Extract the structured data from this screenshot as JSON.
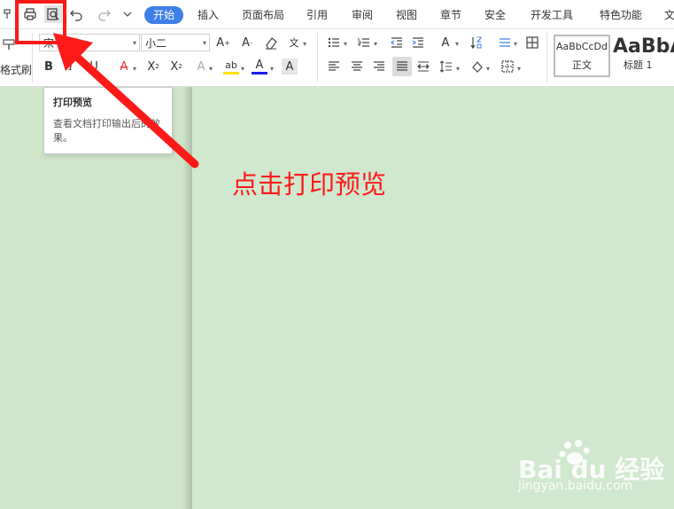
{
  "quick_access": {
    "icons": [
      "painter-icon",
      "print-icon",
      "print-preview-icon",
      "undo-icon",
      "redo-icon",
      "more-dropdown-icon"
    ]
  },
  "menu_tabs": [
    {
      "label": "开始",
      "active": true
    },
    {
      "label": "插入"
    },
    {
      "label": "页面布局"
    },
    {
      "label": "引用"
    },
    {
      "label": "审阅"
    },
    {
      "label": "视图"
    },
    {
      "label": "章节"
    },
    {
      "label": "安全"
    },
    {
      "label": "开发工具"
    },
    {
      "label": "特色功能"
    },
    {
      "label": "文"
    }
  ],
  "ribbon": {
    "format_painter_label": "格式刷",
    "font_name": "宋",
    "font_size": "小二",
    "bold": "B",
    "italic": "I",
    "font_color_letter": "A",
    "styles": [
      {
        "sample": "AaBbCcDd",
        "name": "正文"
      },
      {
        "sample": "AaBbA",
        "name": "标题 1"
      }
    ]
  },
  "tooltip": {
    "title": "打印预览",
    "body": "查看文档打印输出后的效果。"
  },
  "annotation": {
    "text": "点击打印预览",
    "color": "#ff1a1a"
  },
  "watermark": {
    "logo": "Bai du 经验",
    "url": "jingyan.baidu.com"
  },
  "colors": {
    "accent": "#3f7fe8",
    "page_background": "#d0e8cd",
    "highlight": "#ff1a1a"
  }
}
